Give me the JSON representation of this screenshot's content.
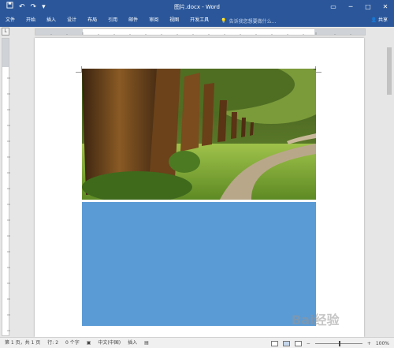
{
  "titlebar": {
    "title": "图片.docx - Word",
    "qat": {
      "save_icon": "save-icon",
      "undo_icon": "undo-icon",
      "redo_icon": "redo-icon",
      "customize_icon": "chevron-down-icon"
    },
    "window_controls": {
      "ribbon_display": "▭",
      "minimize": "─",
      "maximize": "□",
      "close": "✕"
    }
  },
  "ribbon": {
    "tabs": [
      "文件",
      "开始",
      "插入",
      "设计",
      "布局",
      "引用",
      "邮件",
      "审阅",
      "视图",
      "开发工具"
    ],
    "tell_me_placeholder": "告诉我您想要做什么...",
    "share_label": "共享"
  },
  "ruler": {
    "corner_label": "L"
  },
  "statusbar": {
    "page_info": "第 1 页，共 1 页",
    "line_info": "行: 2",
    "word_count": "0 个字",
    "language": "中文(中国)",
    "insert_mode": "插入",
    "zoom": "100%"
  },
  "watermark": "Bai经验",
  "colors": {
    "ribbon_bg": "#2b579a",
    "shape_fill": "#5b9bd5"
  }
}
